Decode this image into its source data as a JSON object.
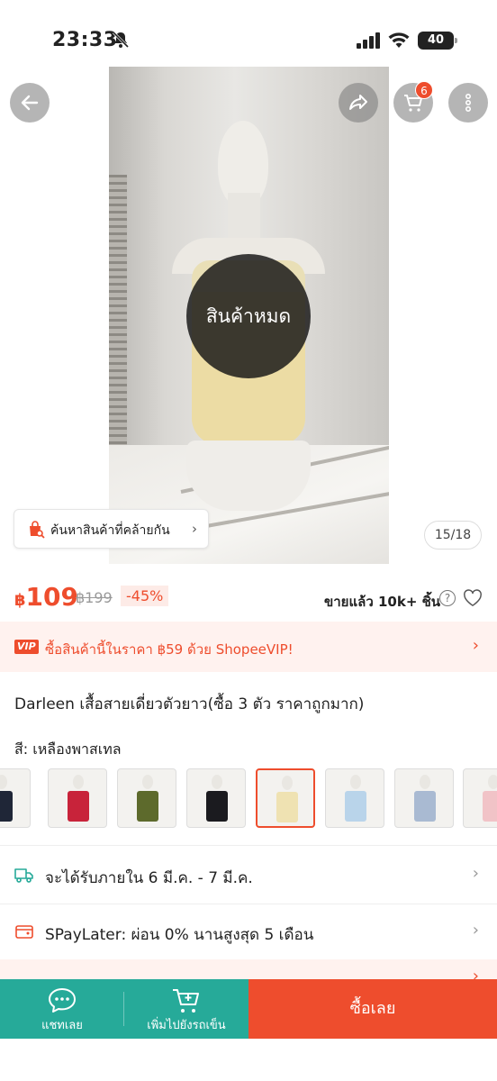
{
  "status_bar": {
    "time": "23:33",
    "battery": "40"
  },
  "header": {
    "cart_count": "6"
  },
  "product_image": {
    "overlay": "สินค้าหมด",
    "counter": "15/18"
  },
  "similar": {
    "label": "ค้นหาสินค้าที่คล้ายกัน"
  },
  "price": {
    "currency": "฿",
    "current": "109",
    "original": "฿199",
    "discount": "-45%"
  },
  "sold": {
    "label": "ขายแล้ว 10k+ ชิ้น"
  },
  "vip_banner": {
    "badge": "VIP",
    "text": "ซื้อสินค้านี้ในราคา ฿59 ด้วย ShopeeVIP!"
  },
  "product": {
    "title": "Darleen เสื้อสายเดี่ยวตัวยาว(ซื้อ 3 ตัว ราคาถูกมาก)"
  },
  "variation": {
    "label": "สี: เหลืองพาสเทล",
    "swatches": [
      {
        "color": "#1f2637"
      },
      {
        "color": "#c8233a"
      },
      {
        "color": "#5d6a2c"
      },
      {
        "color": "#1b1b1f"
      },
      {
        "color": "#efe2b2",
        "selected": true
      },
      {
        "color": "#b9d4ea"
      },
      {
        "color": "#a9bad2"
      },
      {
        "color": "#f1c3c7"
      }
    ]
  },
  "delivery": {
    "text": "จะได้รับภายใน 6 มี.ค. - 7 มี.ค."
  },
  "paylater": {
    "text": "SPayLater: ผ่อน 0% นานสูงสุด   5 เดือน"
  },
  "bottom_bar": {
    "chat": "แชทเลย",
    "add_to_cart": "เพิ่มไปยังรถเข็น",
    "buy_now": "ซื้อเลย"
  },
  "colors": {
    "primary": "#ee4d2d",
    "secondary": "#26aa99"
  }
}
